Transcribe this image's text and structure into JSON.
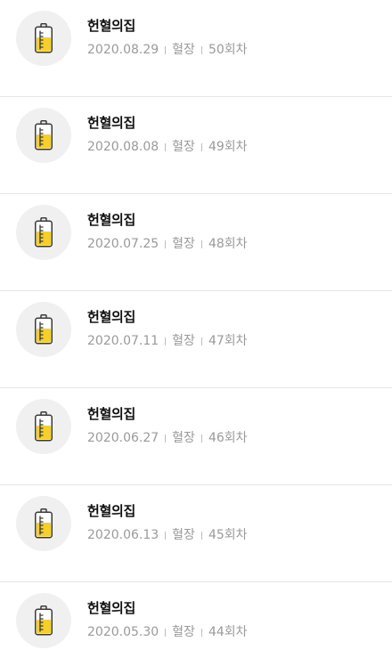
{
  "donation_history": {
    "items": [
      {
        "title": "헌혈의집",
        "date": "2020.08.29",
        "type": "혈장",
        "count": "50회차"
      },
      {
        "title": "헌혈의집",
        "date": "2020.08.08",
        "type": "혈장",
        "count": "49회차"
      },
      {
        "title": "헌혈의집",
        "date": "2020.07.25",
        "type": "혈장",
        "count": "48회차"
      },
      {
        "title": "헌혈의집",
        "date": "2020.07.11",
        "type": "혈장",
        "count": "47회차"
      },
      {
        "title": "헌혈의집",
        "date": "2020.06.27",
        "type": "혈장",
        "count": "46회차"
      },
      {
        "title": "헌혈의집",
        "date": "2020.06.13",
        "type": "혈장",
        "count": "45회차"
      },
      {
        "title": "헌혈의집",
        "date": "2020.05.30",
        "type": "혈장",
        "count": "44회차"
      }
    ],
    "icon": "plasma-bag-icon",
    "colors": {
      "icon_fill": "#f5cf2a",
      "icon_outline": "#3a3a3a",
      "avatar_bg": "#f0f0f0",
      "title_text": "#111111",
      "meta_text": "#9a9a9a"
    }
  }
}
